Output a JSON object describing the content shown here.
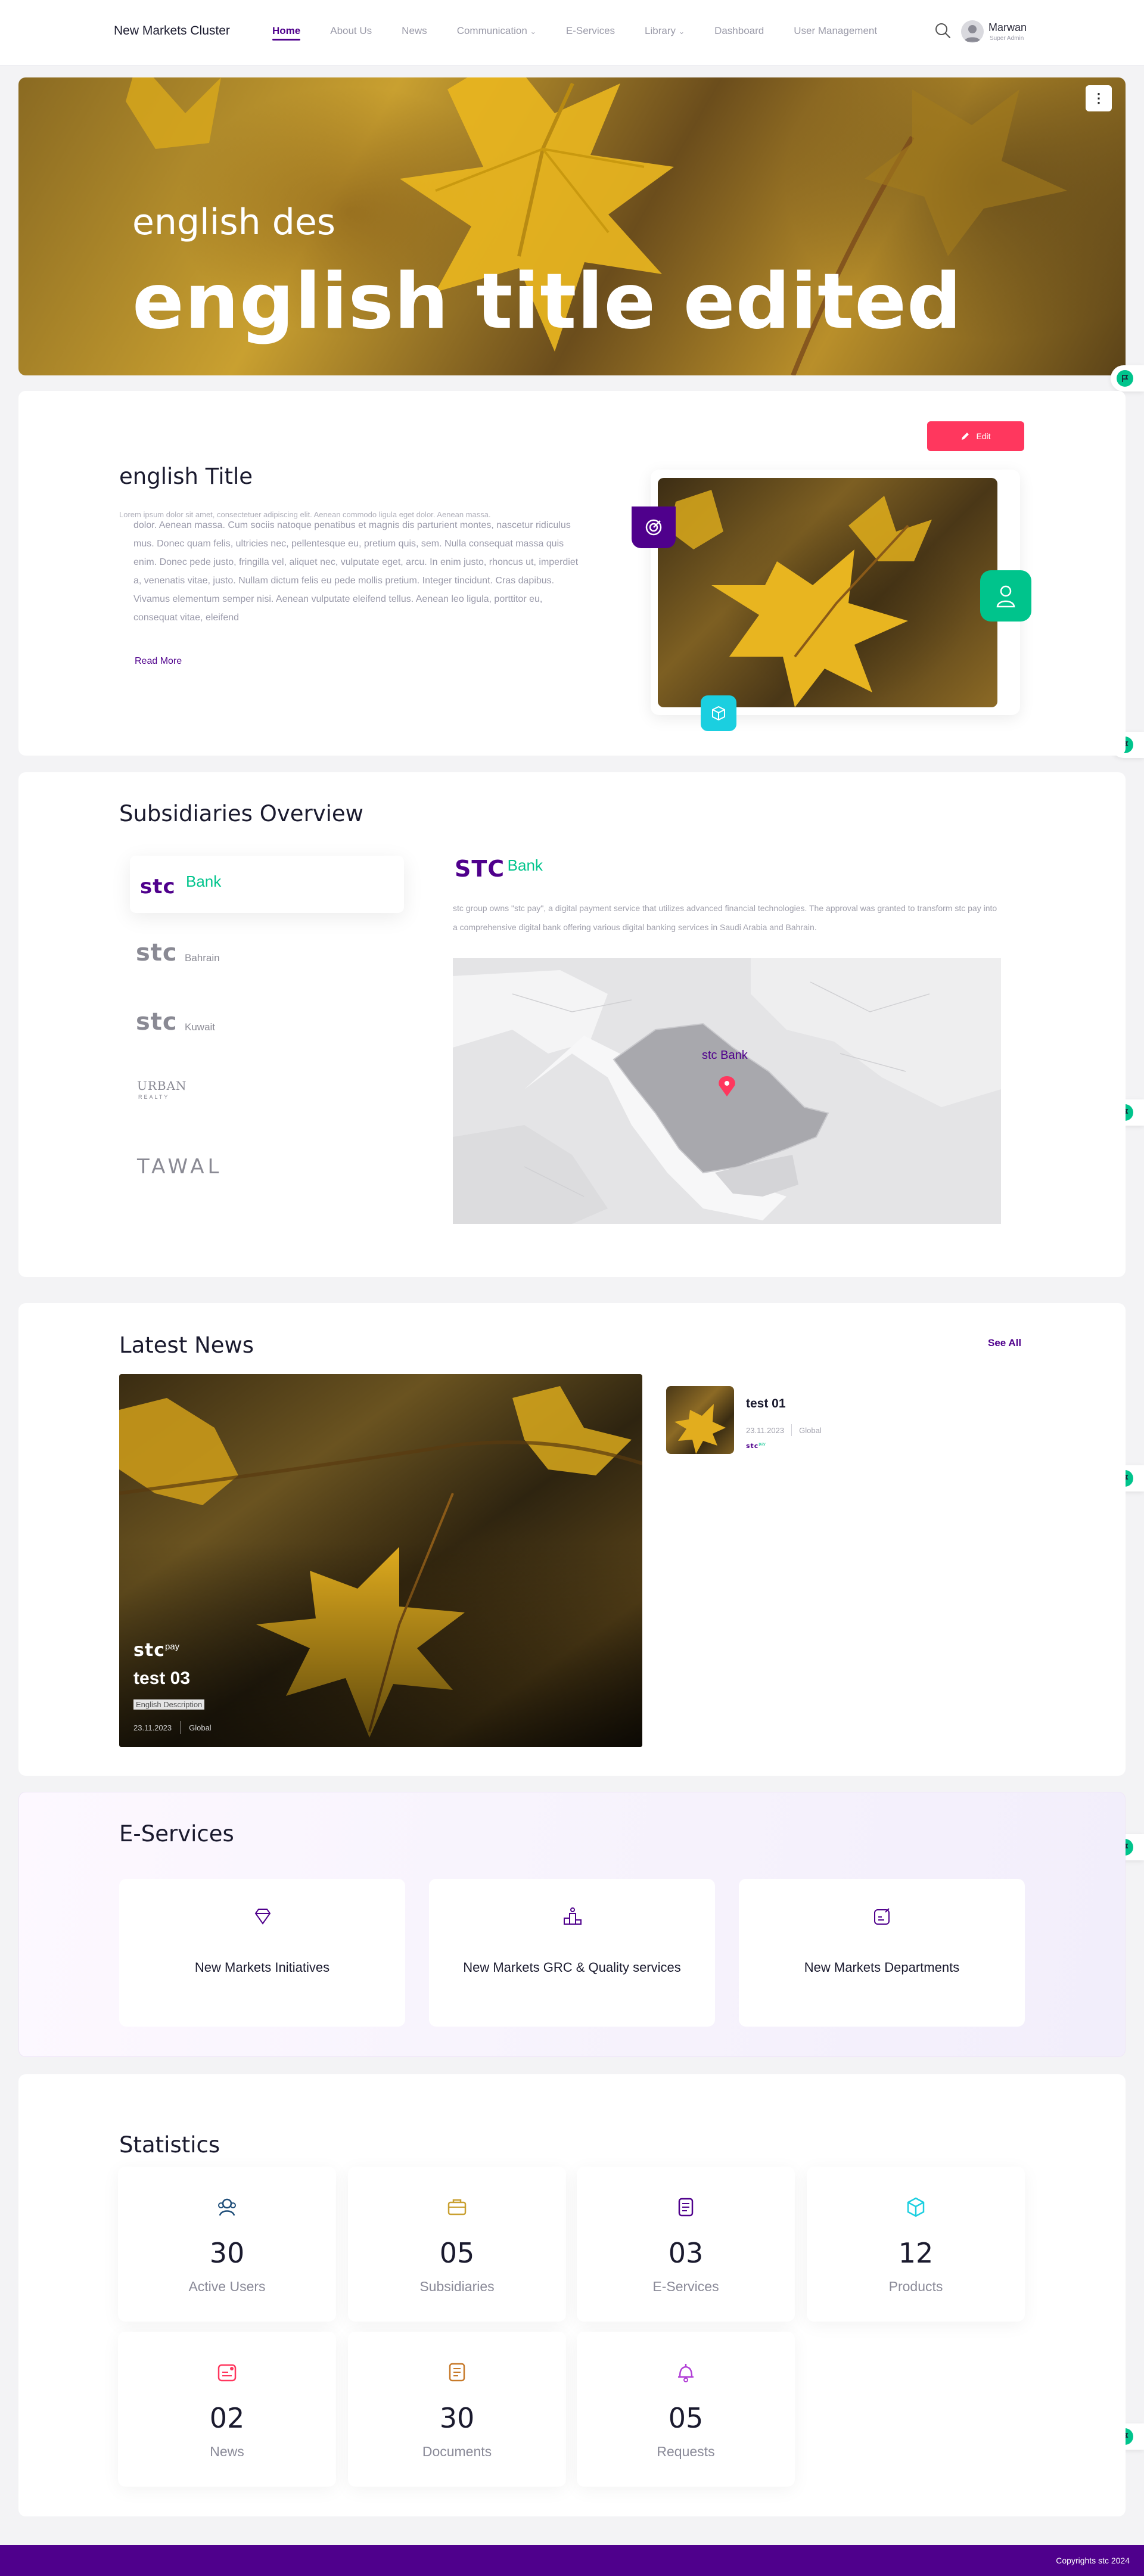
{
  "header": {
    "brand": "New Markets Cluster",
    "nav": [
      {
        "label": "Home",
        "active": true
      },
      {
        "label": "About Us"
      },
      {
        "label": "News"
      },
      {
        "label": "Communication",
        "dropdown": true
      },
      {
        "label": "E-Services"
      },
      {
        "label": "Library",
        "dropdown": true
      },
      {
        "label": "Dashboard"
      },
      {
        "label": "User Management"
      }
    ],
    "user": {
      "name": "Marwan",
      "role": "Super Admin"
    }
  },
  "hero": {
    "subtitle": "english des",
    "title": "english title edited",
    "menu_glyph": "⋮"
  },
  "about": {
    "edit_label": "Edit",
    "title": "english Title",
    "overlay_text": "Lorem ipsum dolor sit amet, consectetuer adipiscing elit. Aenean commodo ligula eget dolor. Aenean massa.",
    "body": "dolor. Aenean massa. Cum sociis natoque penatibus et magnis dis parturient montes, nascetur ridiculus mus. Donec quam felis, ultricies nec, pellentesque eu, pretium quis, sem. Nulla consequat massa quis enim. Donec pede justo, fringilla vel, aliquet nec, vulputate eget, arcu. In enim justo, rhoncus ut, imperdiet a, venenatis vitae, justo. Nullam dictum felis eu pede mollis pretium. Integer tincidunt. Cras dapibus. Vivamus elementum semper nisi. Aenean vulputate eleifend tellus. Aenean leo ligula, porttitor eu, consequat vitae, eleifend",
    "read_more": "Read More"
  },
  "subsidiaries": {
    "title": "Subsidiaries Overview",
    "items": [
      {
        "logo": "stc",
        "suffix": "Bank",
        "active": true
      },
      {
        "logo": "stc",
        "suffix": "Bahrain"
      },
      {
        "logo": "stc",
        "suffix": "Kuwait"
      },
      {
        "logo": "URBAN",
        "suffix": "REALTY"
      },
      {
        "logo": "TAWAL",
        "suffix": ""
      }
    ],
    "detail": {
      "logo": "STC",
      "logo_suffix": "Bank",
      "description": "stc group owns \"stc pay\", a digital payment service that utilizes advanced financial technologies. The approval was granted to transform stc pay into a comprehensive digital bank offering various digital banking services in Saudi Arabia and Bahrain.",
      "map_label": "stc Bank"
    }
  },
  "news": {
    "title": "Latest News",
    "see_all": "See All",
    "featured": {
      "logo": "stc",
      "logo_sup": "pay",
      "title": "test 03",
      "description": "English Description",
      "date": "23.11.2023",
      "scope": "Global"
    },
    "side": [
      {
        "title": "test 01",
        "date": "23.11.2023",
        "scope": "Global",
        "logo": "stc",
        "logo_sup": "pay"
      }
    ]
  },
  "eservices": {
    "title": "E-Services",
    "items": [
      {
        "label": "New Markets Initiatives",
        "icon": "diamond-icon"
      },
      {
        "label": "New Markets GRC & Quality services",
        "icon": "podium-icon"
      },
      {
        "label": "New Markets Departments",
        "icon": "edit-box-icon"
      }
    ]
  },
  "statistics": {
    "title": "Statistics",
    "items": [
      {
        "value": "30",
        "label": "Active Users",
        "icon": "users-icon",
        "color": "#1f4e79"
      },
      {
        "value": "05",
        "label": "Subsidiaries",
        "icon": "briefcase-icon",
        "color": "#c9a030"
      },
      {
        "value": "03",
        "label": "E-Services",
        "icon": "services-icon",
        "color": "#4f008c"
      },
      {
        "value": "12",
        "label": "Products",
        "icon": "box-icon",
        "color": "#1bcfe0"
      },
      {
        "value": "02",
        "label": "News",
        "icon": "news-icon",
        "color": "#ff375e"
      },
      {
        "value": "30",
        "label": "Documents",
        "icon": "document-icon",
        "color": "#c77a2a"
      },
      {
        "value": "05",
        "label": "Requests",
        "icon": "bell-icon",
        "color": "#b13fd6"
      }
    ]
  },
  "footer": {
    "copyright": "Copyrights stc 2024"
  },
  "colors": {
    "primary": "#4f008c",
    "accent": "#ff375e",
    "green": "#00c48c",
    "cyan": "#1bcfe0"
  }
}
